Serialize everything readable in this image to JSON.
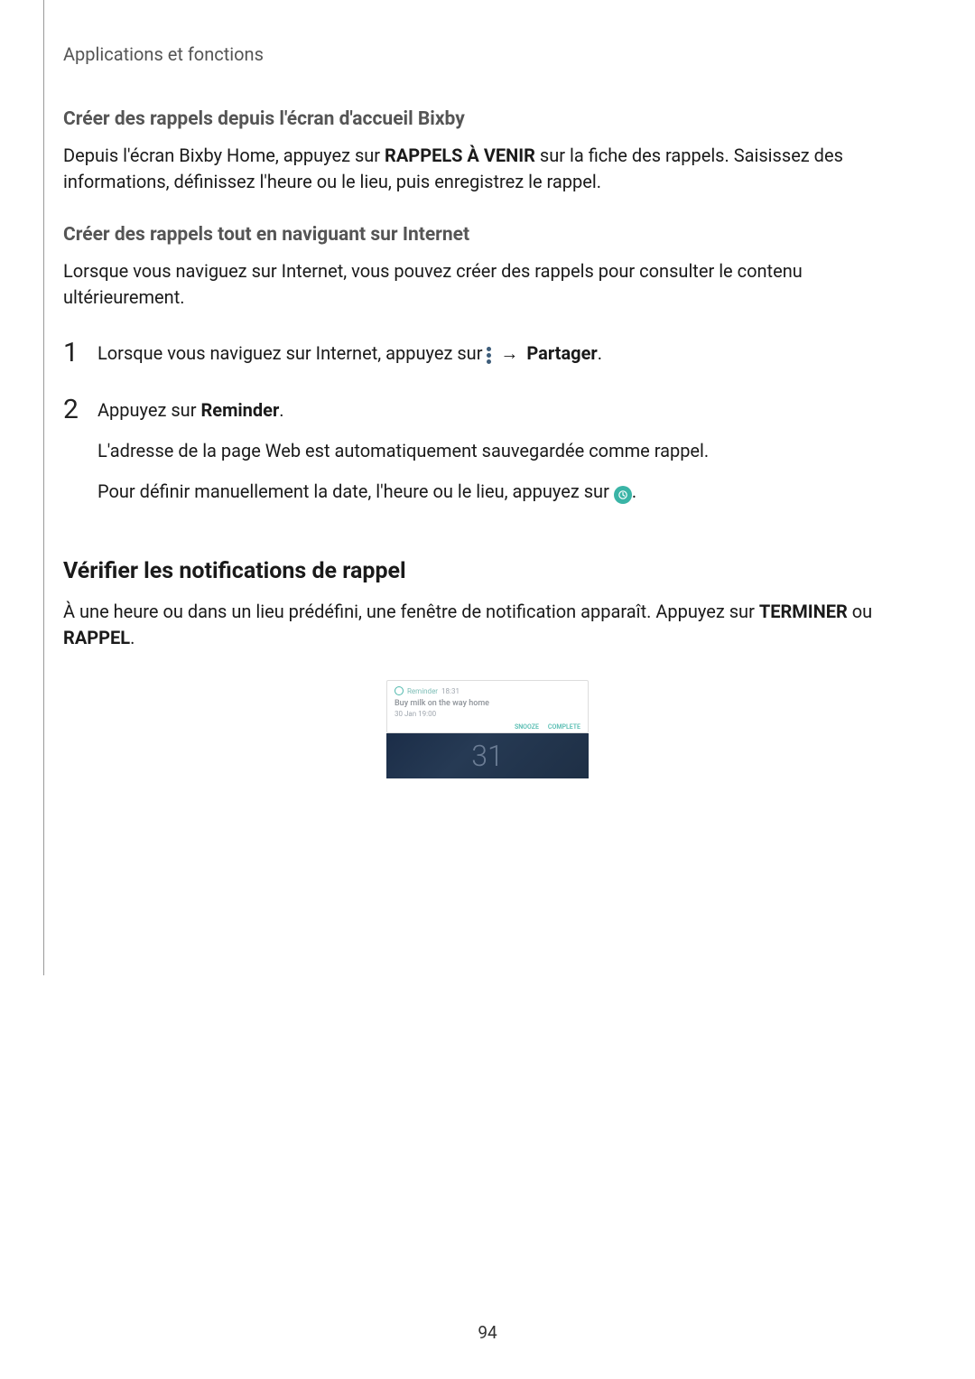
{
  "breadcrumb": "Applications et fonctions",
  "section1": {
    "heading": "Créer des rappels depuis l'écran d'accueil Bixby",
    "p1_a": "Depuis l'écran Bixby Home, appuyez sur ",
    "p1_bold": "RAPPELS À VENIR",
    "p1_b": " sur la fiche des rappels. Saisissez des informations, définissez l'heure ou le lieu, puis enregistrez le rappel."
  },
  "section2": {
    "heading": "Créer des rappels tout en naviguant sur Internet",
    "p1": "Lorsque vous naviguez sur Internet, vous pouvez créer des rappels pour consulter le contenu ultérieurement.",
    "step1_num": "1",
    "step1_a": "Lorsque vous naviguez sur Internet, appuyez sur ",
    "step1_arrow": "→",
    "step1_bold": "Partager",
    "step1_dot": ".",
    "step2_num": "2",
    "step2_a": "Appuyez sur ",
    "step2_bold": "Reminder",
    "step2_b": ".",
    "step2_p2": "L'adresse de la page Web est automatiquement sauvegardée comme rappel.",
    "step2_p3a": "Pour définir manuellement la date, l'heure ou le lieu, appuyez sur ",
    "step2_p3b": "."
  },
  "section3": {
    "heading": "Vérifier les notifications de rappel",
    "p1_a": "À une heure ou dans un lieu prédéfini, une fenêtre de notification apparaît. Appuyez sur ",
    "p1_bold1": "TERMINER",
    "p1_mid": " ou ",
    "p1_bold2": "RAPPEL",
    "p1_b": "."
  },
  "notif": {
    "app": "Reminder",
    "time": "18:31",
    "title": "Buy milk on the way home",
    "subtitle": "30 Jan 19:00",
    "action1": "SNOOZE",
    "action2": "COMPLETE",
    "bgnum": "31"
  },
  "icons": {
    "more": "more-dots-icon",
    "clock": "clock-icon"
  },
  "page": "94"
}
